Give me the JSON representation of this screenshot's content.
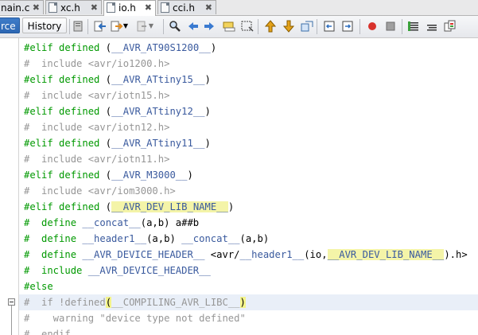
{
  "tabs": [
    {
      "label": "nain.c",
      "close": "✖"
    },
    {
      "label": "xc.h",
      "close": "✖"
    },
    {
      "label": "io.h",
      "close": "✖"
    },
    {
      "label": "cci.h",
      "close": "✖"
    }
  ],
  "toolbar": {
    "source_label": "rce",
    "history_label": "History",
    "icons": [
      "last-edit-icon",
      "back-icon",
      "forward-icon",
      "forward-dropdown-icon",
      "find-icon",
      "find-prev-icon",
      "find-next-icon",
      "toggle-highlight-icon",
      "toggle-rect-select-icon",
      "prev-bookmark-icon",
      "next-bookmark-icon",
      "toggle-bookmark-icon",
      "shift-left-icon",
      "shift-right-icon",
      "record-macro-icon",
      "stop-macro-icon",
      "comment-icon",
      "uncomment-icon",
      "diff-icon"
    ]
  },
  "code_lines": [
    {
      "segments": [
        {
          "t": "#elif ",
          "c": "kw"
        },
        {
          "t": "defined",
          "c": "kw"
        },
        {
          "t": " (",
          "c": ""
        },
        {
          "t": "__AVR_AT90S1200__",
          "c": "mac"
        },
        {
          "t": ")",
          "c": ""
        }
      ]
    },
    {
      "segments": [
        {
          "t": "#  include <avr/io1200.h>",
          "c": "cm"
        }
      ]
    },
    {
      "segments": [
        {
          "t": "#elif ",
          "c": "kw"
        },
        {
          "t": "defined",
          "c": "kw"
        },
        {
          "t": " (",
          "c": ""
        },
        {
          "t": "__AVR_ATtiny15__",
          "c": "mac"
        },
        {
          "t": ")",
          "c": ""
        }
      ]
    },
    {
      "segments": [
        {
          "t": "#  include <avr/iotn15.h>",
          "c": "cm"
        }
      ]
    },
    {
      "segments": [
        {
          "t": "#elif ",
          "c": "kw"
        },
        {
          "t": "defined",
          "c": "kw"
        },
        {
          "t": " (",
          "c": ""
        },
        {
          "t": "__AVR_ATtiny12__",
          "c": "mac"
        },
        {
          "t": ")",
          "c": ""
        }
      ]
    },
    {
      "segments": [
        {
          "t": "#  include <avr/iotn12.h>",
          "c": "cm"
        }
      ]
    },
    {
      "segments": [
        {
          "t": "#elif ",
          "c": "kw"
        },
        {
          "t": "defined",
          "c": "kw"
        },
        {
          "t": " (",
          "c": ""
        },
        {
          "t": "__AVR_ATtiny11__",
          "c": "mac"
        },
        {
          "t": ")",
          "c": ""
        }
      ]
    },
    {
      "segments": [
        {
          "t": "#  include <avr/iotn11.h>",
          "c": "cm"
        }
      ]
    },
    {
      "segments": [
        {
          "t": "#elif ",
          "c": "kw"
        },
        {
          "t": "defined",
          "c": "kw"
        },
        {
          "t": " (",
          "c": ""
        },
        {
          "t": "__AVR_M3000__",
          "c": "mac"
        },
        {
          "t": ")",
          "c": ""
        }
      ]
    },
    {
      "segments": [
        {
          "t": "#  include <avr/iom3000.h>",
          "c": "cm"
        }
      ]
    },
    {
      "segments": [
        {
          "t": "#elif ",
          "c": "kw"
        },
        {
          "t": "defined",
          "c": "kw"
        },
        {
          "t": " (",
          "c": ""
        },
        {
          "t": "__AVR_DEV_LIB_NAME__",
          "c": "mac mk"
        },
        {
          "t": ")",
          "c": ""
        }
      ]
    },
    {
      "segments": [
        {
          "t": "#  define ",
          "c": "kw"
        },
        {
          "t": "__concat__",
          "c": "mac"
        },
        {
          "t": "(a,b) a##b",
          "c": ""
        }
      ]
    },
    {
      "segments": [
        {
          "t": "#  define ",
          "c": "kw"
        },
        {
          "t": "__header1__",
          "c": "mac"
        },
        {
          "t": "(a,b) ",
          "c": ""
        },
        {
          "t": "__concat__",
          "c": "mac"
        },
        {
          "t": "(a,b)",
          "c": ""
        }
      ]
    },
    {
      "segments": [
        {
          "t": "#  define ",
          "c": "kw"
        },
        {
          "t": "__AVR_DEVICE_HEADER__",
          "c": "mac"
        },
        {
          "t": " <avr/",
          "c": ""
        },
        {
          "t": "__header1__",
          "c": "mac"
        },
        {
          "t": "(io,",
          "c": ""
        },
        {
          "t": "__AVR_DEV_LIB_NAME__",
          "c": "mac mk"
        },
        {
          "t": ").h>",
          "c": ""
        }
      ]
    },
    {
      "segments": [
        {
          "t": "#  include ",
          "c": "kw"
        },
        {
          "t": "__AVR_DEVICE_HEADER__",
          "c": "mac"
        }
      ]
    },
    {
      "segments": [
        {
          "t": "#else",
          "c": "kw"
        }
      ]
    },
    {
      "segments": [
        {
          "t": "#  if !defined",
          "c": "cm"
        },
        {
          "t": "(",
          "c": "mkb"
        },
        {
          "t": "__COMPILING_AVR_LIBC__",
          "c": "cm"
        },
        {
          "t": ")",
          "c": "mkb"
        }
      ],
      "current": true
    },
    {
      "segments": [
        {
          "t": "#    warning \"device type not defined\"",
          "c": "cm"
        }
      ]
    },
    {
      "segments": [
        {
          "t": "#  endif",
          "c": "cm"
        }
      ]
    }
  ],
  "colors": {
    "keyword": "#009900",
    "comment": "#969696",
    "macro": "#3a5a9e",
    "mark": "#f4f4a8",
    "current_line": "#e9eff8"
  }
}
